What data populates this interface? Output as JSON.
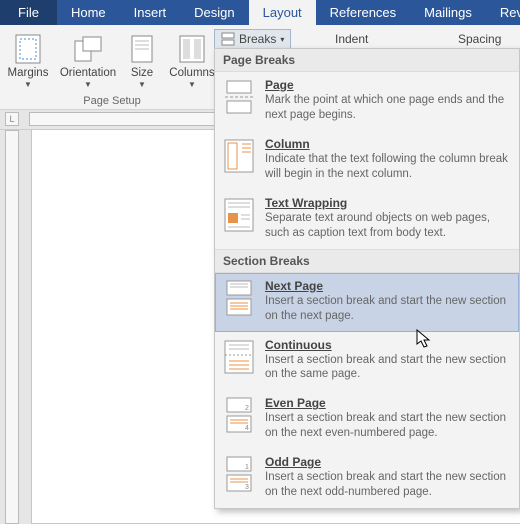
{
  "tabs": {
    "file": "File",
    "home": "Home",
    "insert": "Insert",
    "design": "Design",
    "layout": "Layout",
    "references": "References",
    "mailings": "Mailings",
    "review": "Review"
  },
  "ribbon": {
    "margins": "Margins",
    "orientation": "Orientation",
    "size": "Size",
    "columns": "Columns",
    "breaks": "Breaks",
    "indent": "Indent",
    "spacing": "Spacing",
    "group_label": "Page Setup"
  },
  "dropdown": {
    "page_breaks_header": "Page Breaks",
    "section_breaks_header": "Section Breaks",
    "page": {
      "title": "Page",
      "desc": "Mark the point at which one page ends and the next page begins."
    },
    "column": {
      "title": "Column",
      "desc": "Indicate that the text following the column break will begin in the next column."
    },
    "text_wrapping": {
      "title": "Text Wrapping",
      "desc": "Separate text around objects on web pages, such as caption text from body text."
    },
    "next_page": {
      "title": "Next Page",
      "desc": "Insert a section break and start the new section on the next page."
    },
    "continuous": {
      "title": "Continuous",
      "desc": "Insert a section break and start the new section on the same page."
    },
    "even_page": {
      "title": "Even Page",
      "desc": "Insert a section break and start the new section on the next even-numbered page."
    },
    "odd_page": {
      "title": "Odd Page",
      "desc": "Insert a section break and start the new section on the next odd-numbered page."
    }
  },
  "ruler": {
    "corner": "L"
  }
}
